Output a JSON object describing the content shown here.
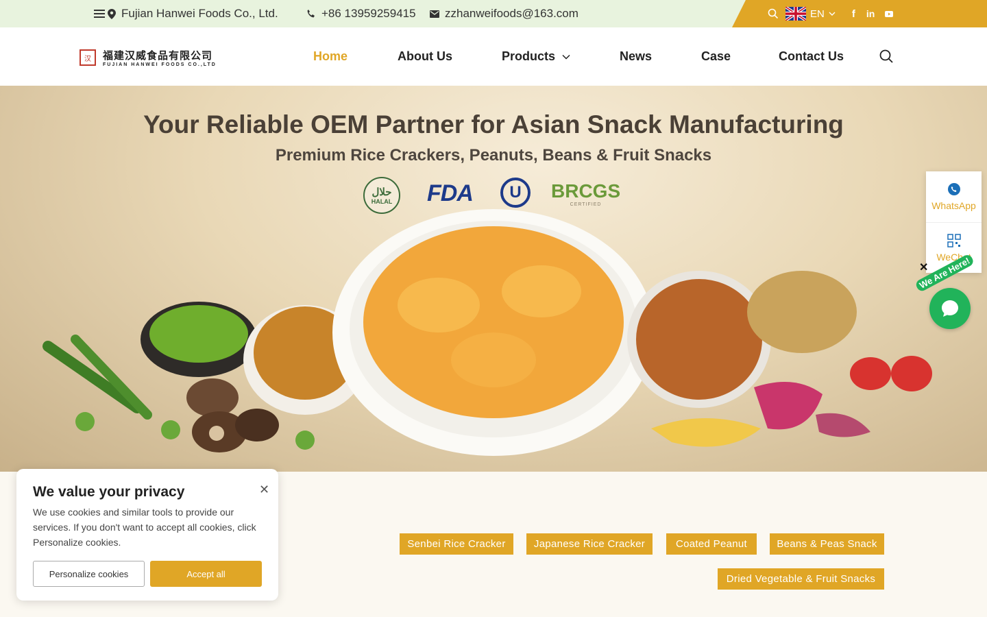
{
  "topbar": {
    "company": "Fujian Hanwei Foods Co., Ltd.",
    "phone": "+86 13959259415",
    "email": "zzhanweifoods@163.com",
    "language": "EN",
    "accent_color": "#e0a626",
    "bg_color": "#e8f3de",
    "social_icons": [
      "facebook-icon",
      "linkedin-icon",
      "youtube-icon"
    ]
  },
  "logo": {
    "cn": "福建汉威食品有限公司",
    "en": "FUJIAN HANWEI FOODS CO.,LTD"
  },
  "nav": {
    "items": [
      {
        "label": "Home",
        "active": true
      },
      {
        "label": "About Us"
      },
      {
        "label": "Products",
        "dropdown": true
      },
      {
        "label": "News"
      },
      {
        "label": "Case"
      },
      {
        "label": "Contact Us"
      }
    ]
  },
  "hero": {
    "title": "Your Reliable OEM Partner for Asian Snack Manufacturing",
    "subtitle": "Premium Rice Crackers, Peanuts, Beans & Fruit Snacks",
    "certs": {
      "halal": "HALAL",
      "fda": "FDA",
      "u": "U",
      "brcgs": "BRCGS",
      "brcgs_sub": "CERTIFIED"
    }
  },
  "side_widget": {
    "whatsapp": "WhatsApp",
    "wechat": "WeChat",
    "chat_tag": "We Are Here!"
  },
  "categories": [
    "Senbei Rice Cracker",
    "Japanese Rice Cracker",
    "Coated Peanut",
    "Beans & Peas Snack",
    "Dried Vegetable & Fruit Snacks"
  ],
  "cookie": {
    "title": "We value your privacy",
    "text": "We use cookies and similar tools to provide our services. If you don't want to accept all cookies, click Personalize cookies.",
    "personalize": "Personalize cookies",
    "accept": "Accept all"
  }
}
